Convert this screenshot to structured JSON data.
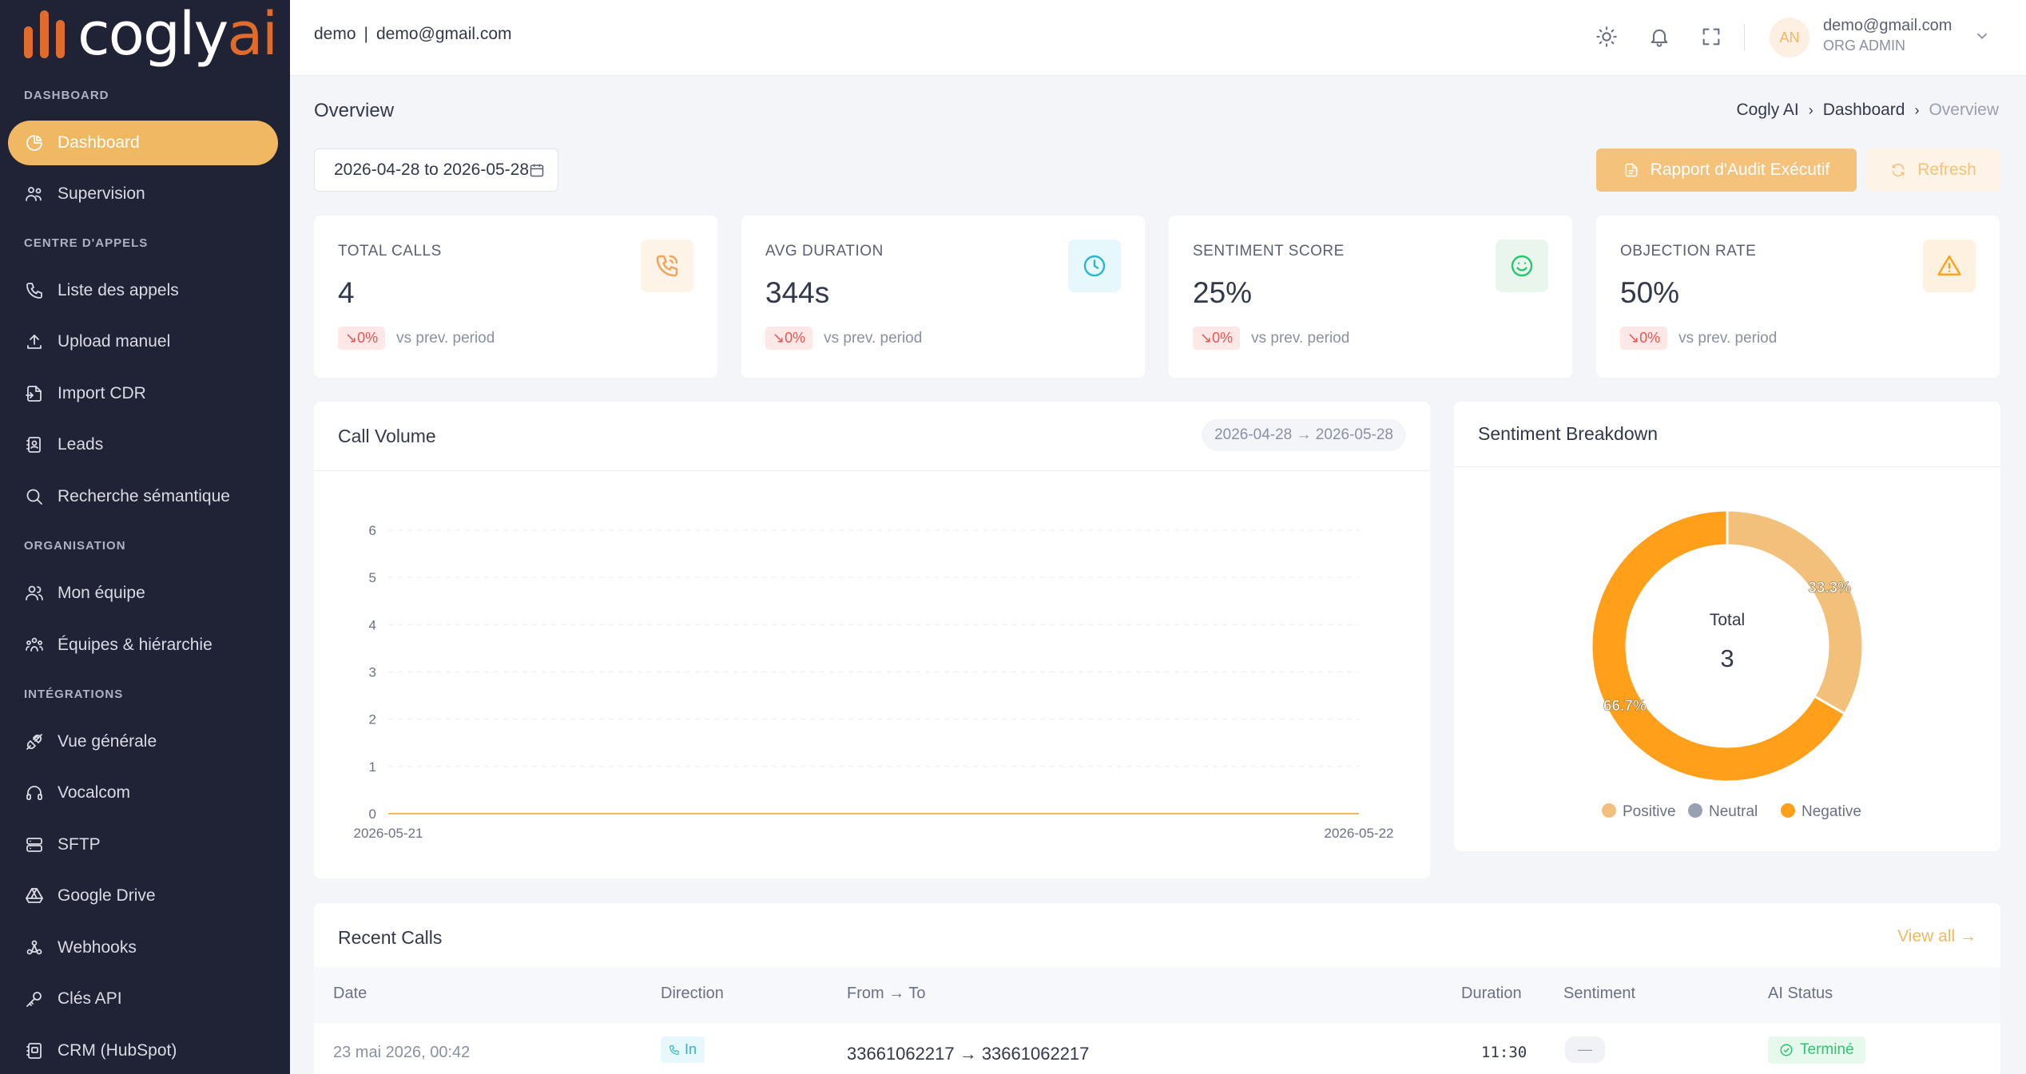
{
  "brand": {
    "logo_text": "cogly",
    "logo_accent": "ai",
    "accent_color": "#e06b2c",
    "primary_color": "#f0b862"
  },
  "sidebar": {
    "sections": [
      {
        "label": "DASHBOARD"
      },
      {
        "label": "CENTRE D'APPELS"
      },
      {
        "label": "ORGANISATION"
      },
      {
        "label": "INTÉGRATIONS"
      }
    ],
    "items": [
      {
        "label": "Dashboard",
        "icon": "pie-chart-icon",
        "active": true
      },
      {
        "label": "Supervision",
        "icon": "users-icon"
      },
      {
        "label": "Liste des appels",
        "icon": "phone-icon"
      },
      {
        "label": "Upload manuel",
        "icon": "upload-icon"
      },
      {
        "label": "Import CDR",
        "icon": "file-import-icon"
      },
      {
        "label": "Leads",
        "icon": "contacts-icon"
      },
      {
        "label": "Recherche sémantique",
        "icon": "search-icon"
      },
      {
        "label": "Mon équipe",
        "icon": "user-group-icon"
      },
      {
        "label": "Équipes & hiérarchie",
        "icon": "hierarchy-icon"
      },
      {
        "label": "Vue générale",
        "icon": "plug-icon"
      },
      {
        "label": "Vocalcom",
        "icon": "headset-icon"
      },
      {
        "label": "SFTP",
        "icon": "server-icon"
      },
      {
        "label": "Google Drive",
        "icon": "drive-icon"
      },
      {
        "label": "Webhooks",
        "icon": "webhook-icon"
      },
      {
        "label": "Clés API",
        "icon": "key-icon"
      },
      {
        "label": "CRM (HubSpot)",
        "icon": "crm-icon"
      }
    ]
  },
  "topbar": {
    "org": "demo",
    "separator": "|",
    "email": "demo@gmail.com",
    "avatar_initials": "AN",
    "user_email": "demo@gmail.com",
    "user_role": "ORG ADMIN"
  },
  "page": {
    "title": "Overview",
    "breadcrumb": [
      "Cogly AI",
      "Dashboard",
      "Overview"
    ],
    "date_range": "2026-04-28 to 2026-05-28",
    "report_button": "Rapport d'Audit Exécutif",
    "refresh_button": "Refresh"
  },
  "stats": [
    {
      "label": "TOTAL CALLS",
      "value": "4",
      "delta": "↘0%",
      "note": "vs prev. period",
      "icon": "phone-call-icon",
      "icon_color": "#f0a35c",
      "icon_bg": "#fdf3e6"
    },
    {
      "label": "AVG DURATION",
      "value": "344s",
      "delta": "↘0%",
      "note": "vs prev. period",
      "icon": "clock-icon",
      "icon_color": "#2bb6c9",
      "icon_bg": "#e6f8fb"
    },
    {
      "label": "SENTIMENT SCORE",
      "value": "25%",
      "delta": "↘0%",
      "note": "vs prev. period",
      "icon": "smile-icon",
      "icon_color": "#28c76f",
      "icon_bg": "#eaf5ee"
    },
    {
      "label": "OBJECTION RATE",
      "value": "50%",
      "delta": "↘0%",
      "note": "vs prev. period",
      "icon": "alert-triangle-icon",
      "icon_color": "#ff9f1a",
      "icon_bg": "#fff1e0"
    }
  ],
  "call_volume": {
    "title": "Call Volume",
    "range": "2026-04-28 → 2026-05-28"
  },
  "sentiment": {
    "title": "Sentiment Breakdown",
    "center_label": "Total",
    "center_value": "3"
  },
  "recent_calls": {
    "title": "Recent Calls",
    "view_all": "View all →",
    "columns": [
      "Date",
      "Direction",
      "From → To",
      "Duration",
      "Sentiment",
      "AI Status"
    ],
    "rows": [
      {
        "date": "23 mai 2026, 00:42",
        "direction": "In",
        "from_to": "33661062217 → 33661062217",
        "duration": "11:30",
        "sentiment": "—",
        "ai_status": "Terminé"
      }
    ]
  },
  "chart_data": [
    {
      "type": "line",
      "title": "Call Volume",
      "x": [
        "2026-05-21",
        "2026-05-22"
      ],
      "series": [
        {
          "values": [
            0,
            0
          ]
        }
      ],
      "ylim": [
        0,
        6
      ],
      "yticks": [
        0,
        1,
        2,
        3,
        4,
        5,
        6
      ],
      "grid": true
    },
    {
      "type": "pie",
      "title": "Sentiment Breakdown",
      "labels": [
        "Positive",
        "Neutral",
        "Negative"
      ],
      "values": [
        1,
        0,
        2
      ],
      "percent_labels": [
        "33.3%",
        "",
        "66.7%"
      ],
      "colors": [
        "#f2c07a",
        "#9aa0b4",
        "#ff9f1a"
      ],
      "legend": "bottom",
      "donut": true
    }
  ]
}
